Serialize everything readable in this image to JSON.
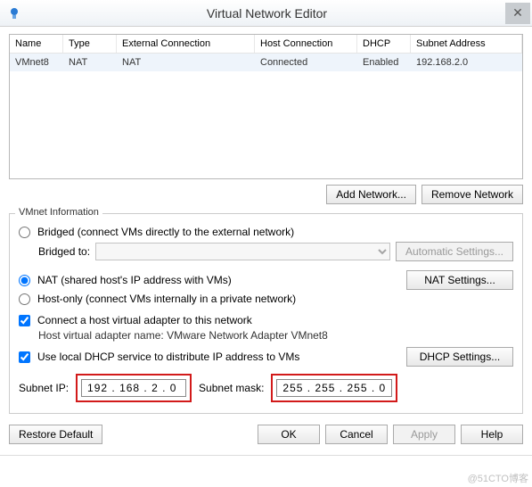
{
  "window": {
    "title": "Virtual Network Editor",
    "close_glyph": "✕"
  },
  "grid": {
    "headers": {
      "name": "Name",
      "type": "Type",
      "ext": "External Connection",
      "host": "Host Connection",
      "dhcp": "DHCP",
      "subnet": "Subnet Address"
    },
    "row": {
      "name": "VMnet8",
      "type": "NAT",
      "ext": "NAT",
      "host": "Connected",
      "dhcp": "Enabled",
      "subnet": "192.168.2.0"
    }
  },
  "buttons": {
    "add_network": "Add Network...",
    "remove_network": "Remove Network",
    "automatic_settings": "Automatic Settings...",
    "nat_settings": "NAT Settings...",
    "dhcp_settings": "DHCP Settings...",
    "restore_default": "Restore Default",
    "ok": "OK",
    "cancel": "Cancel",
    "apply": "Apply",
    "help": "Help"
  },
  "vmnet": {
    "group_title": "VMnet Information",
    "bridged_label": "Bridged (connect VMs directly to the external network)",
    "bridged_to_label": "Bridged to:",
    "nat_label": "NAT (shared host's IP address with VMs)",
    "hostonly_label": "Host-only (connect VMs internally in a private network)",
    "connect_host_label": "Connect a host virtual adapter to this network",
    "host_adapter_info": "Host virtual adapter name: VMware Network Adapter VMnet8",
    "use_dhcp_label": "Use local DHCP service to distribute IP address to VMs",
    "subnet_ip_label": "Subnet IP:",
    "subnet_ip_value": "192 . 168 .  2  .  0",
    "subnet_mask_label": "Subnet mask:",
    "subnet_mask_value": "255 . 255 . 255 .  0"
  },
  "watermark": "@51CTO博客"
}
